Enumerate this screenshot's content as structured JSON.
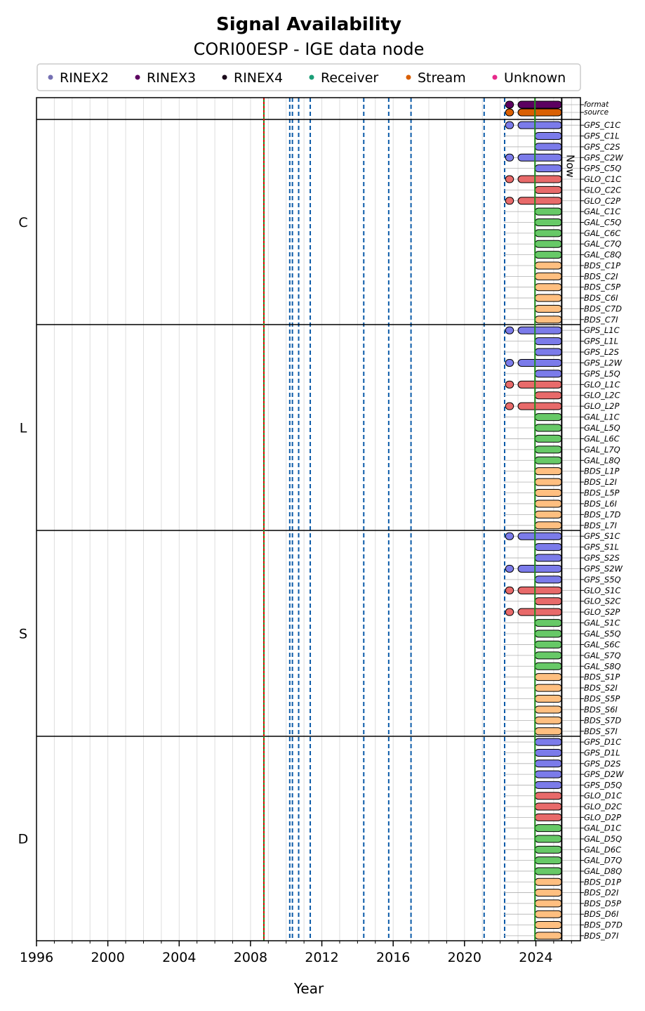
{
  "chart_data": {
    "type": "timeline",
    "title": "Signal Availability",
    "subtitle": "CORI00ESP - IGE data node",
    "xlabel": "Year",
    "xlim": [
      1996,
      2026.5
    ],
    "xticks": [
      1996,
      2000,
      2004,
      2008,
      2012,
      2016,
      2020,
      2024
    ],
    "now_label": "Now",
    "now_year": 2025.45,
    "legend": [
      {
        "label": "RINEX2",
        "color": "#7570b3"
      },
      {
        "label": "RINEX3",
        "color": "#5c0060"
      },
      {
        "label": "RINEX4",
        "color": "#1a0a1a"
      },
      {
        "label": "Receiver",
        "color": "#1b9e77"
      },
      {
        "label": "Stream",
        "color": "#d95f02"
      },
      {
        "label": "Unknown",
        "color": "#e7298a"
      }
    ],
    "constellation_colors": {
      "GPS": "#7b7bea",
      "GLO": "#e86a6a",
      "GAL": "#67c967",
      "BDS": "#ffbf80"
    },
    "antenna_change_years": [
      2008.75
    ],
    "receiver_change_years": [
      2008.75,
      2023.95
    ],
    "event_years": [
      2010.2,
      2010.35,
      2010.7,
      2011.35,
      2014.35,
      2015.75,
      2017.0,
      2021.1,
      2022.25
    ],
    "top_rows": [
      {
        "label": "format",
        "segments": [
          [
            2022.3,
            2022.75,
            "#5c0060"
          ],
          [
            2023.0,
            2025.45,
            "#5c0060"
          ]
        ]
      },
      {
        "label": "source",
        "segments": [
          [
            2022.3,
            2022.75,
            "#d95f02"
          ],
          [
            2023.0,
            2025.45,
            "#d95f02"
          ]
        ]
      }
    ],
    "groups": [
      {
        "label": "C",
        "signals": [
          {
            "label": "GPS_C1C",
            "segments": [
              [
                2022.3,
                2022.75
              ],
              [
                2023.0,
                2025.45
              ]
            ]
          },
          {
            "label": "GPS_C1L",
            "segments": [
              [
                2023.95,
                2025.45
              ]
            ]
          },
          {
            "label": "GPS_C2S",
            "segments": [
              [
                2023.95,
                2025.45
              ]
            ]
          },
          {
            "label": "GPS_C2W",
            "segments": [
              [
                2022.3,
                2022.75
              ],
              [
                2023.0,
                2025.45
              ]
            ]
          },
          {
            "label": "GPS_C5Q",
            "segments": [
              [
                2023.95,
                2025.45
              ]
            ]
          },
          {
            "label": "GLO_C1C",
            "segments": [
              [
                2022.3,
                2022.75
              ],
              [
                2023.0,
                2025.45
              ]
            ]
          },
          {
            "label": "GLO_C2C",
            "segments": [
              [
                2023.95,
                2025.45
              ]
            ]
          },
          {
            "label": "GLO_C2P",
            "segments": [
              [
                2022.3,
                2022.75
              ],
              [
                2023.0,
                2025.45
              ]
            ]
          },
          {
            "label": "GAL_C1C",
            "segments": [
              [
                2023.95,
                2025.45
              ]
            ]
          },
          {
            "label": "GAL_C5Q",
            "segments": [
              [
                2023.95,
                2025.45
              ]
            ]
          },
          {
            "label": "GAL_C6C",
            "segments": [
              [
                2023.95,
                2025.45
              ]
            ]
          },
          {
            "label": "GAL_C7Q",
            "segments": [
              [
                2023.95,
                2025.45
              ]
            ]
          },
          {
            "label": "GAL_C8Q",
            "segments": [
              [
                2023.95,
                2025.45
              ]
            ]
          },
          {
            "label": "BDS_C1P",
            "segments": [
              [
                2023.95,
                2025.45
              ]
            ]
          },
          {
            "label": "BDS_C2I",
            "segments": [
              [
                2023.95,
                2025.45
              ]
            ]
          },
          {
            "label": "BDS_C5P",
            "segments": [
              [
                2023.95,
                2025.45
              ]
            ]
          },
          {
            "label": "BDS_C6I",
            "segments": [
              [
                2023.95,
                2025.45
              ]
            ]
          },
          {
            "label": "BDS_C7D",
            "segments": [
              [
                2023.95,
                2025.45
              ]
            ]
          },
          {
            "label": "BDS_C7I",
            "segments": [
              [
                2023.95,
                2025.45
              ]
            ]
          }
        ]
      },
      {
        "label": "L",
        "signals": [
          {
            "label": "GPS_L1C",
            "segments": [
              [
                2022.3,
                2022.75
              ],
              [
                2023.0,
                2025.45
              ]
            ]
          },
          {
            "label": "GPS_L1L",
            "segments": [
              [
                2023.95,
                2025.45
              ]
            ]
          },
          {
            "label": "GPS_L2S",
            "segments": [
              [
                2023.95,
                2025.45
              ]
            ]
          },
          {
            "label": "GPS_L2W",
            "segments": [
              [
                2022.3,
                2022.75
              ],
              [
                2023.0,
                2025.45
              ]
            ]
          },
          {
            "label": "GPS_L5Q",
            "segments": [
              [
                2023.95,
                2025.45
              ]
            ]
          },
          {
            "label": "GLO_L1C",
            "segments": [
              [
                2022.3,
                2022.75
              ],
              [
                2023.0,
                2025.45
              ]
            ]
          },
          {
            "label": "GLO_L2C",
            "segments": [
              [
                2023.95,
                2025.45
              ]
            ]
          },
          {
            "label": "GLO_L2P",
            "segments": [
              [
                2022.3,
                2022.75
              ],
              [
                2023.0,
                2025.45
              ]
            ]
          },
          {
            "label": "GAL_L1C",
            "segments": [
              [
                2023.95,
                2025.45
              ]
            ]
          },
          {
            "label": "GAL_L5Q",
            "segments": [
              [
                2023.95,
                2025.45
              ]
            ]
          },
          {
            "label": "GAL_L6C",
            "segments": [
              [
                2023.95,
                2025.45
              ]
            ]
          },
          {
            "label": "GAL_L7Q",
            "segments": [
              [
                2023.95,
                2025.45
              ]
            ]
          },
          {
            "label": "GAL_L8Q",
            "segments": [
              [
                2023.95,
                2025.45
              ]
            ]
          },
          {
            "label": "BDS_L1P",
            "segments": [
              [
                2023.95,
                2025.45
              ]
            ]
          },
          {
            "label": "BDS_L2I",
            "segments": [
              [
                2023.95,
                2025.45
              ]
            ]
          },
          {
            "label": "BDS_L5P",
            "segments": [
              [
                2023.95,
                2025.45
              ]
            ]
          },
          {
            "label": "BDS_L6I",
            "segments": [
              [
                2023.95,
                2025.45
              ]
            ]
          },
          {
            "label": "BDS_L7D",
            "segments": [
              [
                2023.95,
                2025.45
              ]
            ]
          },
          {
            "label": "BDS_L7I",
            "segments": [
              [
                2023.95,
                2025.45
              ]
            ]
          }
        ]
      },
      {
        "label": "S",
        "signals": [
          {
            "label": "GPS_S1C",
            "segments": [
              [
                2022.3,
                2022.75
              ],
              [
                2023.0,
                2025.45
              ]
            ]
          },
          {
            "label": "GPS_S1L",
            "segments": [
              [
                2023.95,
                2025.45
              ]
            ]
          },
          {
            "label": "GPS_S2S",
            "segments": [
              [
                2023.95,
                2025.45
              ]
            ]
          },
          {
            "label": "GPS_S2W",
            "segments": [
              [
                2022.3,
                2022.75
              ],
              [
                2023.0,
                2025.45
              ]
            ]
          },
          {
            "label": "GPS_S5Q",
            "segments": [
              [
                2023.95,
                2025.45
              ]
            ]
          },
          {
            "label": "GLO_S1C",
            "segments": [
              [
                2022.3,
                2022.75
              ],
              [
                2023.0,
                2025.45
              ]
            ]
          },
          {
            "label": "GLO_S2C",
            "segments": [
              [
                2023.95,
                2025.45
              ]
            ]
          },
          {
            "label": "GLO_S2P",
            "segments": [
              [
                2022.3,
                2022.75
              ],
              [
                2023.0,
                2025.45
              ]
            ]
          },
          {
            "label": "GAL_S1C",
            "segments": [
              [
                2023.95,
                2025.45
              ]
            ]
          },
          {
            "label": "GAL_S5Q",
            "segments": [
              [
                2023.95,
                2025.45
              ]
            ]
          },
          {
            "label": "GAL_S6C",
            "segments": [
              [
                2023.95,
                2025.45
              ]
            ]
          },
          {
            "label": "GAL_S7Q",
            "segments": [
              [
                2023.95,
                2025.45
              ]
            ]
          },
          {
            "label": "GAL_S8Q",
            "segments": [
              [
                2023.95,
                2025.45
              ]
            ]
          },
          {
            "label": "BDS_S1P",
            "segments": [
              [
                2023.95,
                2025.45
              ]
            ]
          },
          {
            "label": "BDS_S2I",
            "segments": [
              [
                2023.95,
                2025.45
              ]
            ]
          },
          {
            "label": "BDS_S5P",
            "segments": [
              [
                2023.95,
                2025.45
              ]
            ]
          },
          {
            "label": "BDS_S6I",
            "segments": [
              [
                2023.95,
                2025.45
              ]
            ]
          },
          {
            "label": "BDS_S7D",
            "segments": [
              [
                2023.95,
                2025.45
              ]
            ]
          },
          {
            "label": "BDS_S7I",
            "segments": [
              [
                2023.95,
                2025.45
              ]
            ]
          }
        ]
      },
      {
        "label": "D",
        "signals": [
          {
            "label": "GPS_D1C",
            "segments": [
              [
                2023.95,
                2025.45
              ]
            ]
          },
          {
            "label": "GPS_D1L",
            "segments": [
              [
                2023.95,
                2025.45
              ]
            ]
          },
          {
            "label": "GPS_D2S",
            "segments": [
              [
                2023.95,
                2025.45
              ]
            ]
          },
          {
            "label": "GPS_D2W",
            "segments": [
              [
                2023.95,
                2025.45
              ]
            ]
          },
          {
            "label": "GPS_D5Q",
            "segments": [
              [
                2023.95,
                2025.45
              ]
            ]
          },
          {
            "label": "GLO_D1C",
            "segments": [
              [
                2023.95,
                2025.45
              ]
            ]
          },
          {
            "label": "GLO_D2C",
            "segments": [
              [
                2023.95,
                2025.45
              ]
            ]
          },
          {
            "label": "GLO_D2P",
            "segments": [
              [
                2023.95,
                2025.45
              ]
            ]
          },
          {
            "label": "GAL_D1C",
            "segments": [
              [
                2023.95,
                2025.45
              ]
            ]
          },
          {
            "label": "GAL_D5Q",
            "segments": [
              [
                2023.95,
                2025.45
              ]
            ]
          },
          {
            "label": "GAL_D6C",
            "segments": [
              [
                2023.95,
                2025.45
              ]
            ]
          },
          {
            "label": "GAL_D7Q",
            "segments": [
              [
                2023.95,
                2025.45
              ]
            ]
          },
          {
            "label": "GAL_D8Q",
            "segments": [
              [
                2023.95,
                2025.45
              ]
            ]
          },
          {
            "label": "BDS_D1P",
            "segments": [
              [
                2023.95,
                2025.45
              ]
            ]
          },
          {
            "label": "BDS_D2I",
            "segments": [
              [
                2023.95,
                2025.45
              ]
            ]
          },
          {
            "label": "BDS_D5P",
            "segments": [
              [
                2023.95,
                2025.45
              ]
            ]
          },
          {
            "label": "BDS_D6I",
            "segments": [
              [
                2023.95,
                2025.45
              ]
            ]
          },
          {
            "label": "BDS_D7D",
            "segments": [
              [
                2023.95,
                2025.45
              ]
            ]
          },
          {
            "label": "BDS_D7I",
            "segments": [
              [
                2023.95,
                2025.45
              ]
            ]
          }
        ]
      }
    ]
  }
}
